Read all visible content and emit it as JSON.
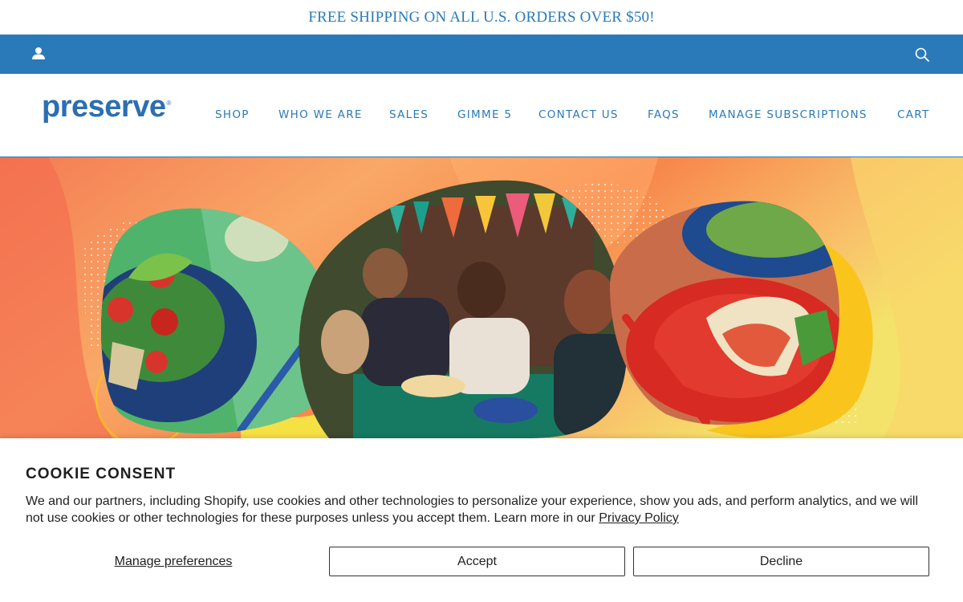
{
  "promo": {
    "text": "FREE SHIPPING ON ALL U.S. ORDERS OVER $50!"
  },
  "utility": {
    "account_icon": "user-icon",
    "search_icon": "search-icon"
  },
  "header": {
    "logo_text": "preserve",
    "logo_mark": "®",
    "nav": [
      {
        "label": "SHOP"
      },
      {
        "label": "WHO WE ARE"
      },
      {
        "label": "SALES"
      },
      {
        "label": "GIMME 5"
      },
      {
        "label": "CONTACT US"
      },
      {
        "label": "FAQS"
      },
      {
        "label": "MANAGE SUBSCRIPTIONS"
      },
      {
        "label": "CART"
      }
    ]
  },
  "colors": {
    "brand_blue": "#2a7ab9",
    "hero_orange": "#f7894f",
    "hero_yellow": "#f6d64a"
  },
  "cookie": {
    "title": "COOKIE CONSENT",
    "body": "We and our partners, including Shopify, use cookies and other technologies to personalize your experience, show you ads, and perform analytics, and we will not use cookies or other technologies for these purposes unless you accept them. Learn more in our ",
    "privacy_link": "Privacy Policy",
    "manage_label": "Manage preferences",
    "accept_label": "Accept",
    "decline_label": "Decline"
  }
}
